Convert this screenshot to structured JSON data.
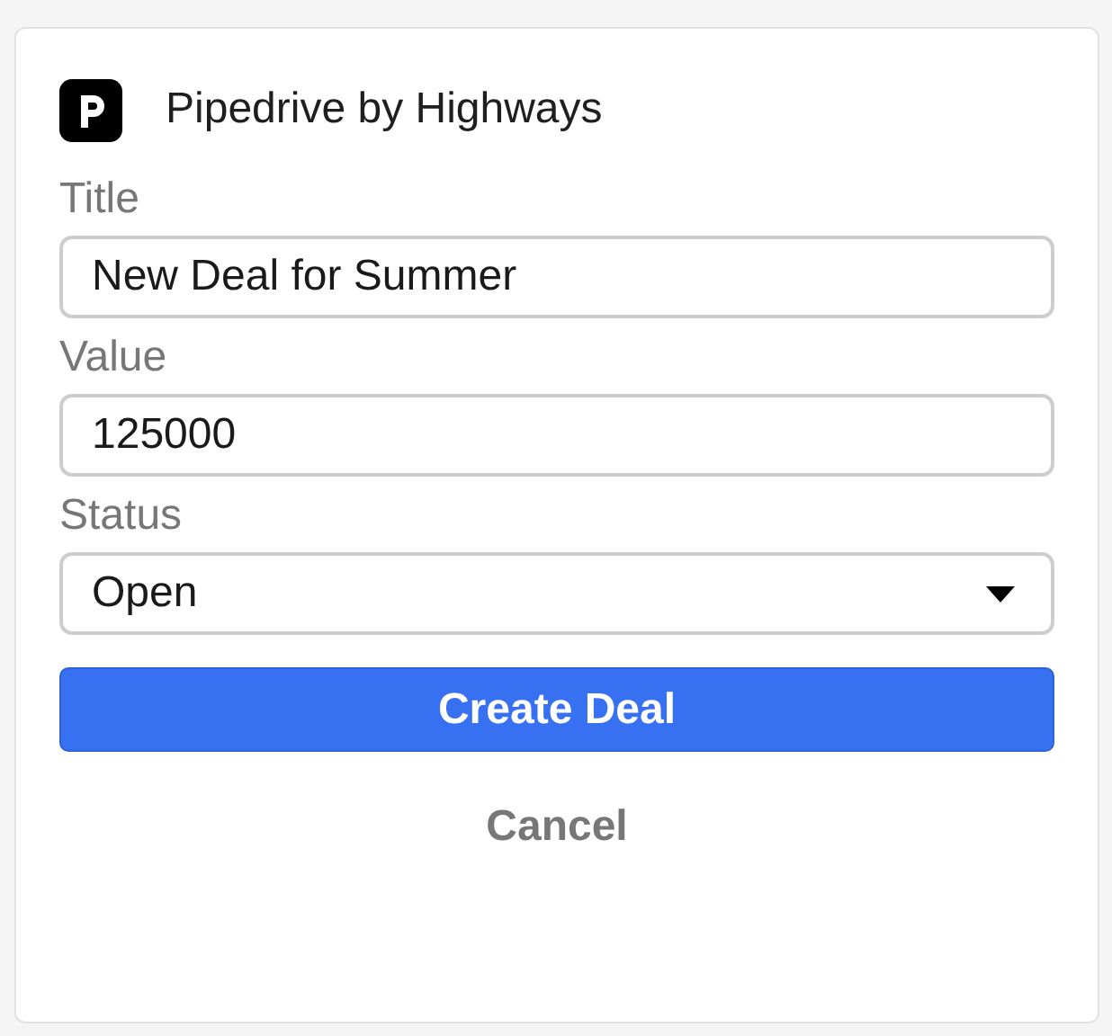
{
  "header": {
    "title": "Pipedrive by Highways"
  },
  "fields": [
    {
      "kind": "text",
      "label": "Title",
      "value": "New Deal for Summer"
    },
    {
      "kind": "text",
      "label": "Value",
      "value": "125000"
    },
    {
      "kind": "select",
      "label": "Status",
      "value": "Open"
    }
  ],
  "buttons": [
    {
      "kind": "primary",
      "label": "Create Deal"
    },
    {
      "kind": "link",
      "label": "Cancel"
    }
  ]
}
